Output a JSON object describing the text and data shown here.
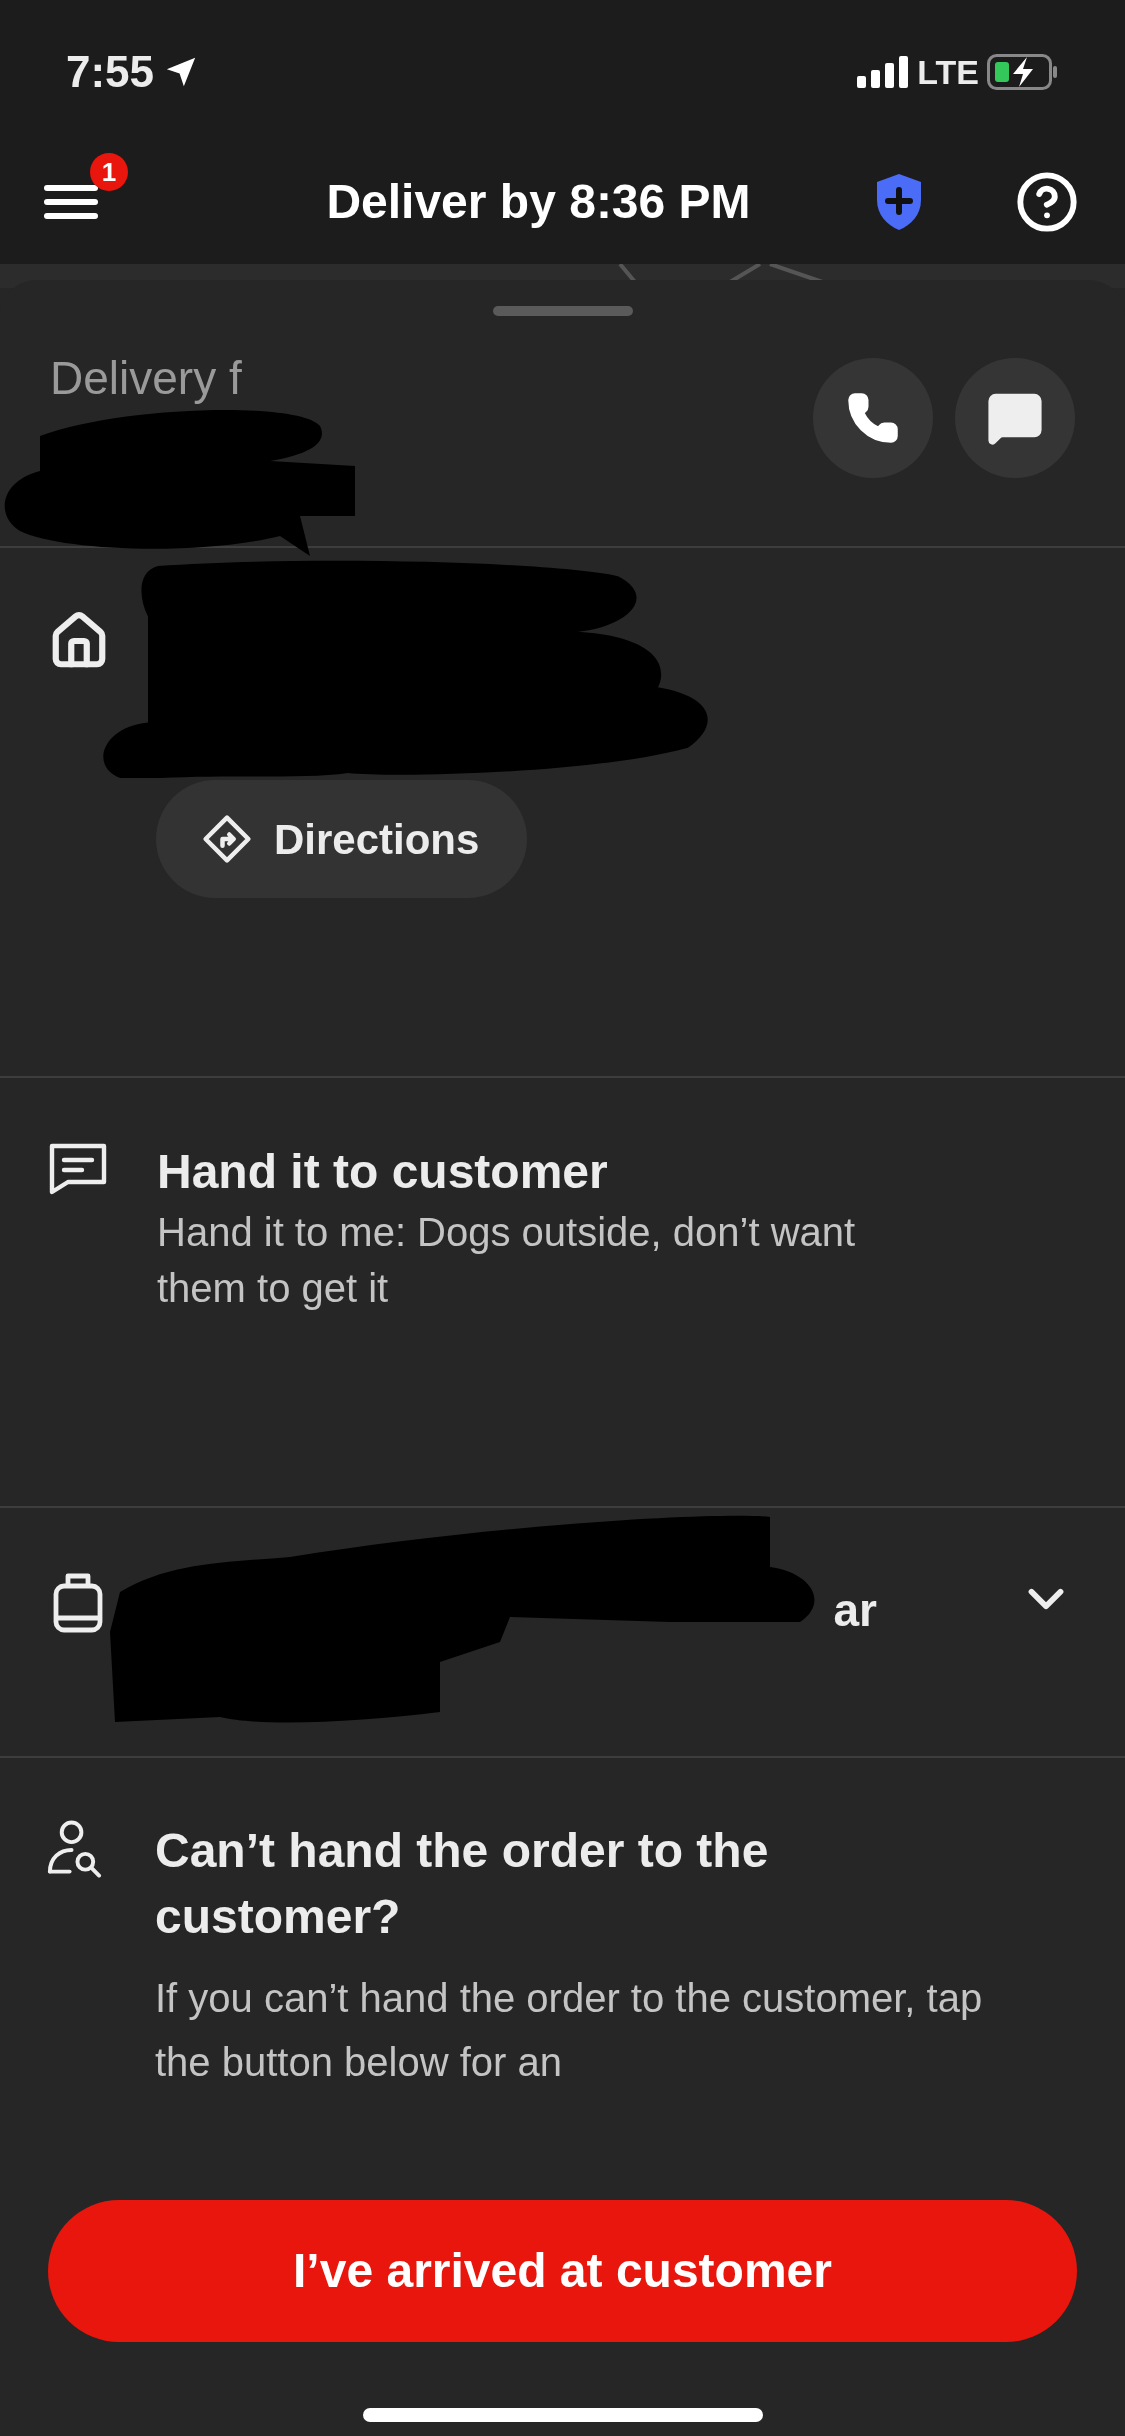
{
  "status_bar": {
    "time": "7:55",
    "network": "LTE"
  },
  "header": {
    "menu_badge": "1",
    "title": "Deliver by 8:36 PM"
  },
  "customer": {
    "label": "Delivery f"
  },
  "address": {
    "directions_button": "Directions"
  },
  "instructions": {
    "title": "Hand it to customer",
    "body": "Hand it to me: Dogs outside, don’t want them to get it"
  },
  "order": {
    "summary_fragment": "ar",
    "expanded": false
  },
  "help": {
    "title": "Can’t hand the order to the customer?",
    "body": "If you can’t hand the order to the customer, tap the button below for an"
  },
  "primary_button": "I’ve arrived at customer"
}
